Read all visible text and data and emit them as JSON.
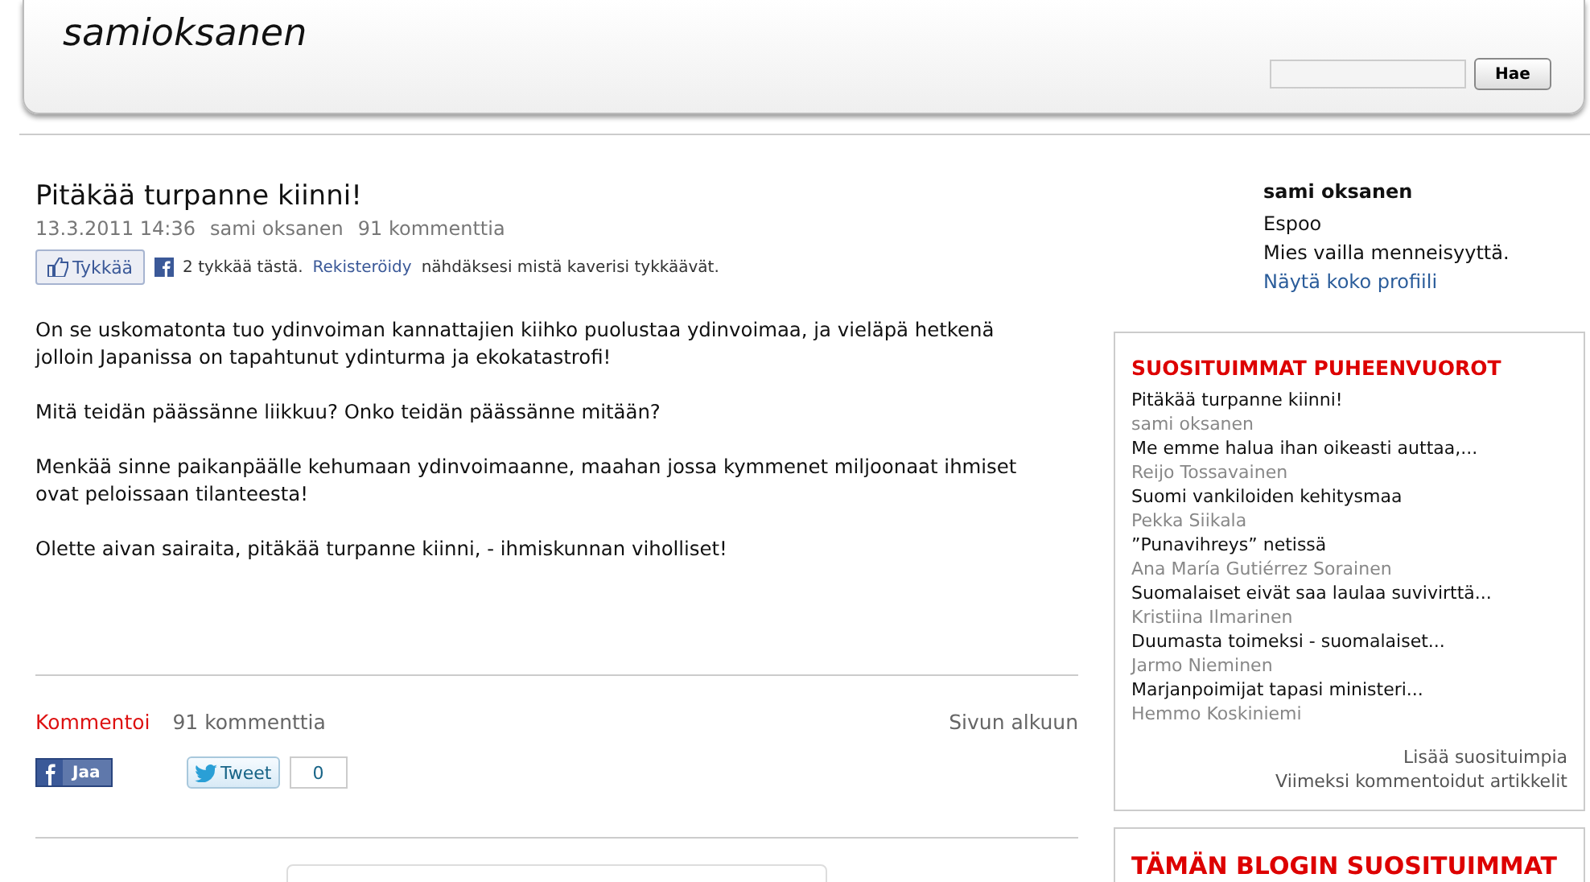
{
  "header": {
    "site_title": "samioksanen",
    "search": {
      "button": "Hae"
    }
  },
  "article": {
    "title": "Pitäkää turpanne kiinni!",
    "date": "13.3.2011 14:36",
    "author": "sami oksanen",
    "comments": "91 kommenttia",
    "like": {
      "button": "Tykkää",
      "count_text": "2 tykkää tästä.",
      "register_link": "Rekisteröidy",
      "rest": "nähdäksesi mistä kaverisi tykkäävät."
    },
    "paragraphs": [
      "On se uskomatonta tuo ydinvoiman kannattajien kiihko puolustaa ydinvoimaa, ja vieläpä hetkenä jolloin Japanissa on tapahtunut ydinturma ja ekokatastrofi!",
      "Mitä teidän päässänne liikkuu? Onko teidän päässänne mitään?",
      "Menkää sinne paikanpäälle kehumaan ydinvoimaanne, maahan jossa kymmenet miljoonaat ihmiset ovat peloissaan tilanteesta!",
      "Olette aivan sairaita, pitäkää turpanne kiinni, - ihmiskunnan viholliset!"
    ],
    "footer": {
      "comment_link": "Kommentoi",
      "comments": "91 kommenttia",
      "top_link": "Sivun alkuun",
      "share_button": "Jaa",
      "tweet_button": "Tweet",
      "tweet_count": "0"
    }
  },
  "profile": {
    "name": "sami oksanen",
    "location": "Espoo",
    "tagline": "Mies vailla menneisyyttä.",
    "link": "Näytä koko profiili"
  },
  "popular": {
    "title": "SUOSITUIMMAT PUHEENVUOROT",
    "items": [
      {
        "title": "Pitäkää turpanne kiinni!",
        "author": "sami oksanen"
      },
      {
        "title": "Me emme halua ihan oikeasti auttaa,...",
        "author": "Reijo Tossavainen"
      },
      {
        "title": "Suomi vankiloiden kehitysmaa",
        "author": "Pekka Siikala"
      },
      {
        "title": "”Punavihreys” netissä",
        "author": "Ana María Gutiérrez Sorainen"
      },
      {
        "title": "Suomalaiset eivät saa laulaa suvivirttä...",
        "author": "Kristiina Ilmarinen"
      },
      {
        "title": "Duumasta toimeksi - suomalaiset...",
        "author": "Jarmo Nieminen"
      },
      {
        "title": "Marjanpoimijat tapasi ministeri...",
        "author": "Hemmo Koskiniemi"
      }
    ],
    "links": [
      "Lisää suosituimpia",
      "Viimeksi kommentoidut artikkelit"
    ]
  },
  "blog_popular": {
    "title": "TÄMÄN BLOGIN SUOSITUIMMAT"
  }
}
